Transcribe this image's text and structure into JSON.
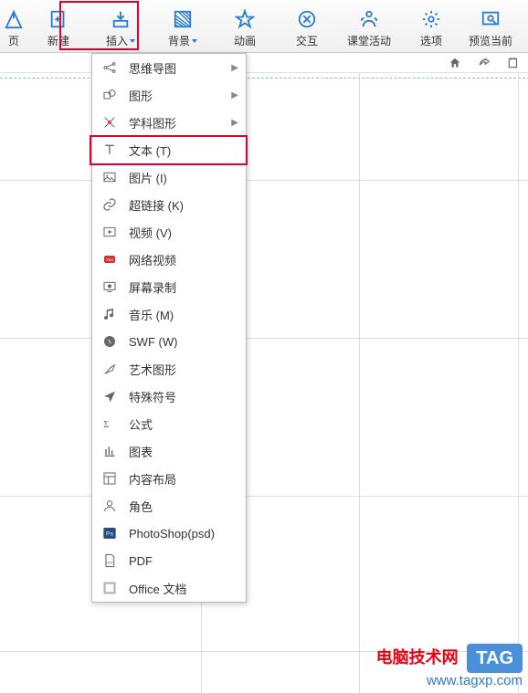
{
  "toolbar": {
    "items": [
      {
        "label": "页"
      },
      {
        "label": "新建"
      },
      {
        "label": "插入"
      },
      {
        "label": "背景"
      },
      {
        "label": "动画"
      },
      {
        "label": "交互"
      },
      {
        "label": "课堂活动"
      },
      {
        "label": "选项"
      },
      {
        "label": "预览当前"
      }
    ]
  },
  "dropdown": {
    "items": [
      {
        "label": "思维导图",
        "arrow": true
      },
      {
        "label": "图形",
        "arrow": true
      },
      {
        "label": "学科图形",
        "arrow": true
      },
      {
        "label": "文本 (T)",
        "arrow": false
      },
      {
        "label": "图片 (I)",
        "arrow": false
      },
      {
        "label": "超链接 (K)",
        "arrow": false
      },
      {
        "label": "视频 (V)",
        "arrow": false
      },
      {
        "label": "网络视频",
        "arrow": false
      },
      {
        "label": "屏幕录制",
        "arrow": false
      },
      {
        "label": "音乐 (M)",
        "arrow": false
      },
      {
        "label": "SWF (W)",
        "arrow": false
      },
      {
        "label": "艺术图形",
        "arrow": false
      },
      {
        "label": "特殊符号",
        "arrow": false
      },
      {
        "label": "公式",
        "arrow": false
      },
      {
        "label": "图表",
        "arrow": false
      },
      {
        "label": "内容布局",
        "arrow": false
      },
      {
        "label": "角色",
        "arrow": false
      },
      {
        "label": "PhotoShop(psd)",
        "arrow": false
      },
      {
        "label": "PDF",
        "arrow": false
      },
      {
        "label": "Office 文档",
        "arrow": false
      }
    ]
  },
  "watermark": {
    "title": "电脑技术网",
    "tag": "TAG",
    "url": "www.tagxp.com"
  }
}
